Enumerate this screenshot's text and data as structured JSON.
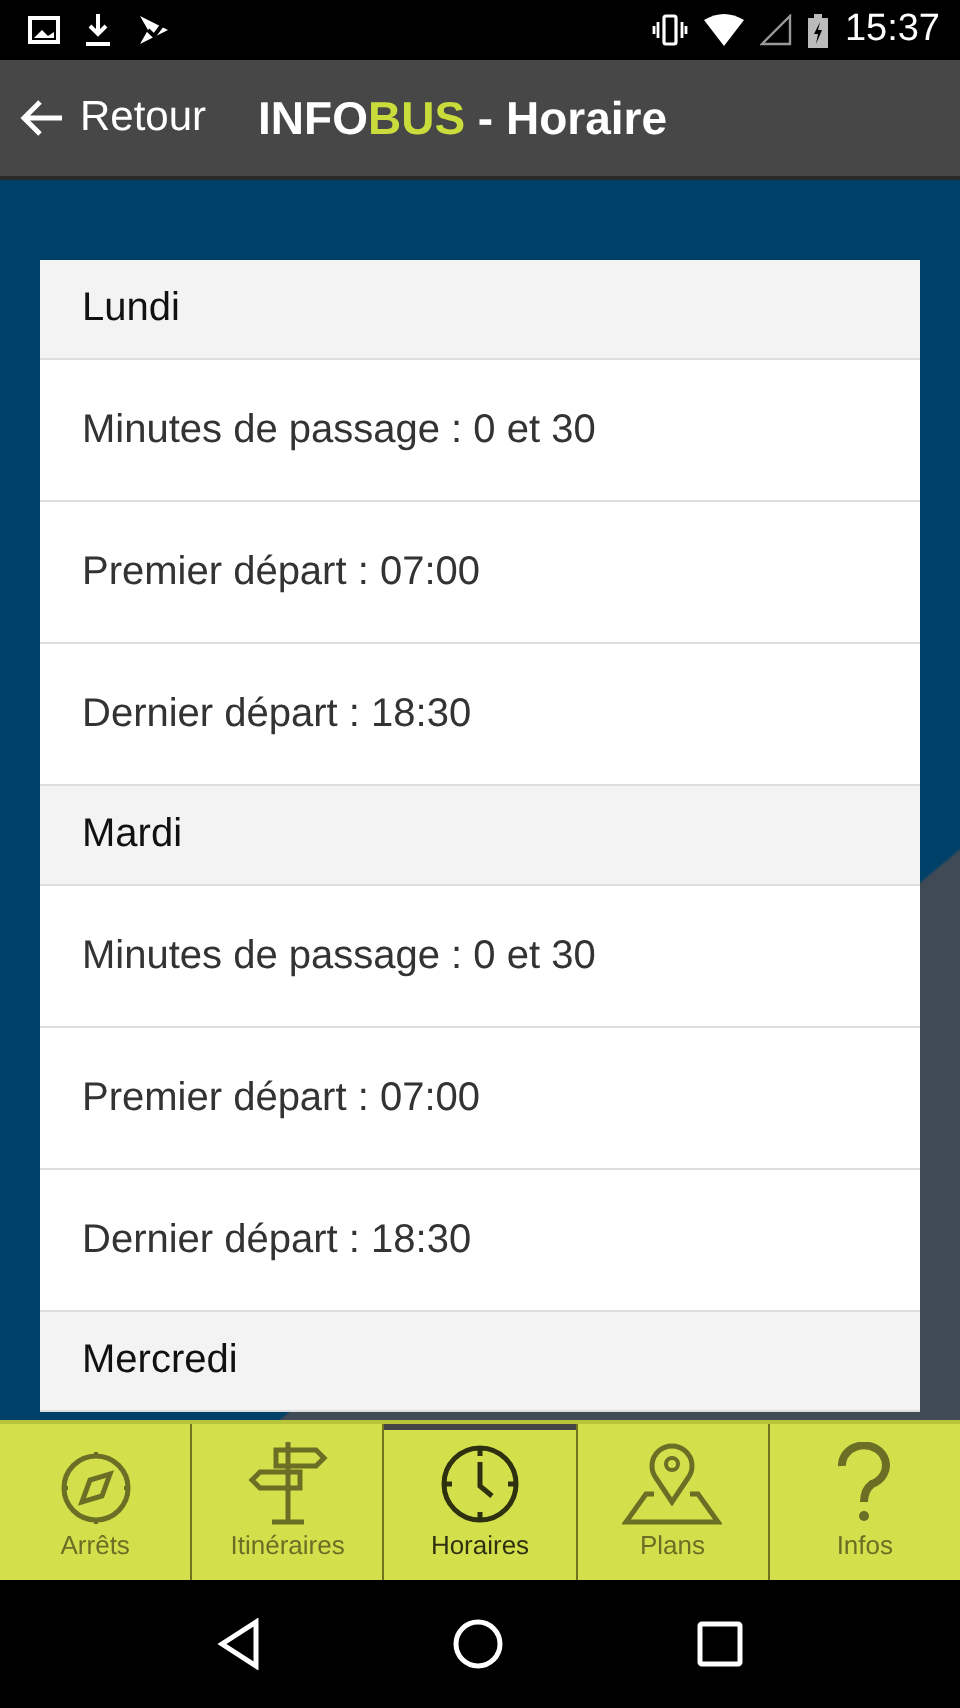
{
  "status_bar": {
    "time": "15:37"
  },
  "header": {
    "back_label": "Retour",
    "title": {
      "prefix": "INFO",
      "highlight": "BUS",
      "suffix": " - Horaire"
    }
  },
  "schedule": [
    {
      "day": "Lundi",
      "rows": [
        "Minutes de passage : 0 et 30",
        "Premier départ : 07:00",
        "Dernier départ : 18:30"
      ]
    },
    {
      "day": "Mardi",
      "rows": [
        "Minutes de passage : 0 et 30",
        "Premier départ : 07:00",
        "Dernier départ : 18:30"
      ]
    },
    {
      "day": "Mercredi"
    }
  ],
  "tabs": [
    {
      "label": "Arrêts",
      "kind": "compass",
      "selected": false
    },
    {
      "label": "Itinéraires",
      "kind": "signpost",
      "selected": false
    },
    {
      "label": "Horaires",
      "kind": "clock",
      "selected": true
    },
    {
      "label": "Plans",
      "kind": "map",
      "selected": false
    },
    {
      "label": "Infos",
      "kind": "question",
      "selected": false
    }
  ]
}
